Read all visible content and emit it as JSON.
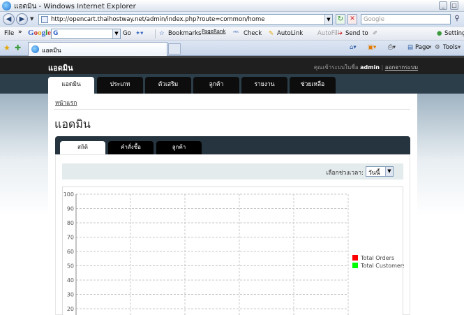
{
  "window": {
    "title": "แอดมิน - Windows Internet Explorer"
  },
  "address": {
    "url": "http://opencart.thaihostway.net/admin/index.php?route=common/home",
    "search_placeholder": "Google"
  },
  "google_toolbar": {
    "file": "File",
    "go": "Go",
    "bookmarks": "Bookmarks",
    "pagerank": "PageRank",
    "check": "Check",
    "autolink": "AutoLink",
    "autofill": "AutoFill",
    "sendto": "Send to",
    "settings": "Settings"
  },
  "tab": {
    "label": "แอดมิน"
  },
  "commands": {
    "page": "Page",
    "tools": "Tools"
  },
  "header": {
    "brand": "แอดมิน",
    "logged_prefix": "คุณเข้าระบบในชื่อ",
    "username": "admin",
    "logout": "ออกจากระบบ"
  },
  "menu": [
    {
      "label": "แอดมิน",
      "active": true
    },
    {
      "label": "ประเภท"
    },
    {
      "label": "ตัวเสริม"
    },
    {
      "label": "ลูกค้า"
    },
    {
      "label": "รายงาน"
    },
    {
      "label": "ช่วยเหลือ"
    }
  ],
  "breadcrumb": "หน้าแรก",
  "heading": "แอดมิน",
  "subtabs": [
    {
      "label": "สถิติ",
      "active": true
    },
    {
      "label": "คำสั่งซื้อ"
    },
    {
      "label": "ลูกค้า"
    }
  ],
  "filter": {
    "label": "เลือกช่วงเวลา:",
    "selected": "วันนี้"
  },
  "chart_data": {
    "type": "line",
    "ylim": [
      0,
      100
    ],
    "yticks": [
      20,
      30,
      40,
      50,
      60,
      70,
      80,
      90,
      100
    ],
    "grid": true,
    "legend_placement": "right",
    "series": [
      {
        "name": "Total Orders",
        "color": "#ff0000",
        "values": []
      },
      {
        "name": "Total Customers",
        "color": "#00ff00",
        "values": []
      }
    ]
  }
}
